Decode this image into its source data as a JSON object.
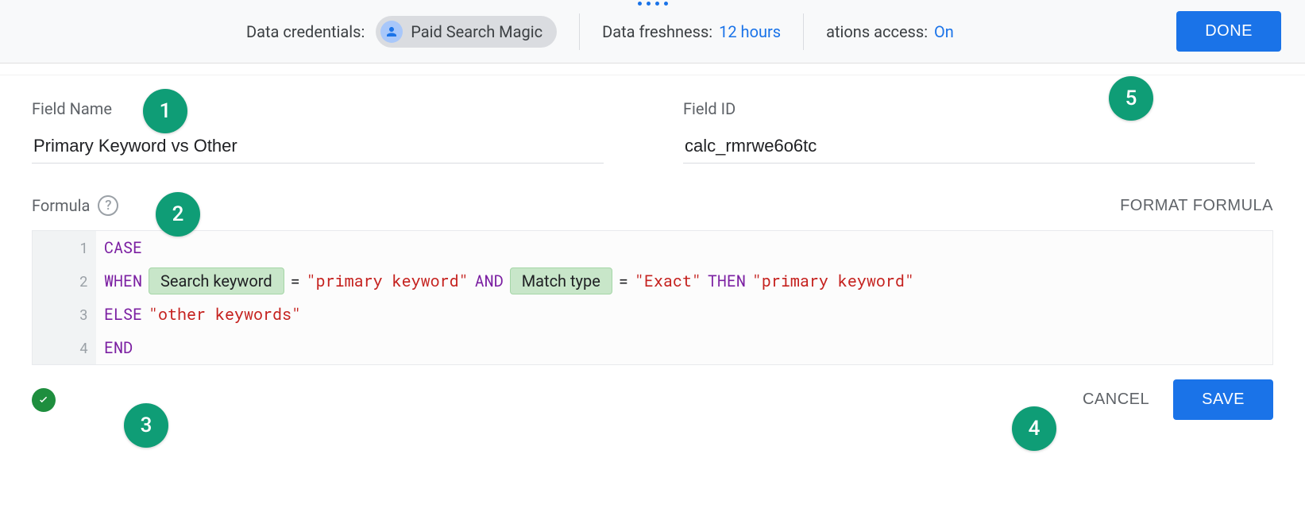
{
  "topbar": {
    "credentials_label": "Data credentials:",
    "credentials_value": "Paid Search Magic",
    "freshness_label": "Data freshness:",
    "freshness_value": "12 hours",
    "access_label": "ations access:",
    "access_value": "On",
    "done": "DONE"
  },
  "fields": {
    "name_label": "Field Name",
    "name_value": "Primary Keyword vs Other",
    "id_label": "Field ID",
    "id_value": "calc_rmrwe6o6tc"
  },
  "formula": {
    "label": "Formula",
    "format_btn": "FORMAT FORMULA",
    "lines": {
      "l1_kw": "CASE",
      "l2_kw1": "WHEN",
      "l2_field1": "Search keyword",
      "l2_op1": "=",
      "l2_str1": "\"primary keyword\"",
      "l2_kw2": "AND",
      "l2_field2": "Match type",
      "l2_op2": "=",
      "l2_str2": "\"Exact\"",
      "l2_kw3": "THEN",
      "l2_str3": "\"primary keyword\"",
      "l3_kw": "ELSE",
      "l3_str": "\"other keywords\"",
      "l4_kw": "END"
    }
  },
  "buttons": {
    "cancel": "CANCEL",
    "save": "SAVE"
  },
  "callouts": {
    "c1": "1",
    "c2": "2",
    "c3": "3",
    "c4": "4",
    "c5": "5"
  }
}
